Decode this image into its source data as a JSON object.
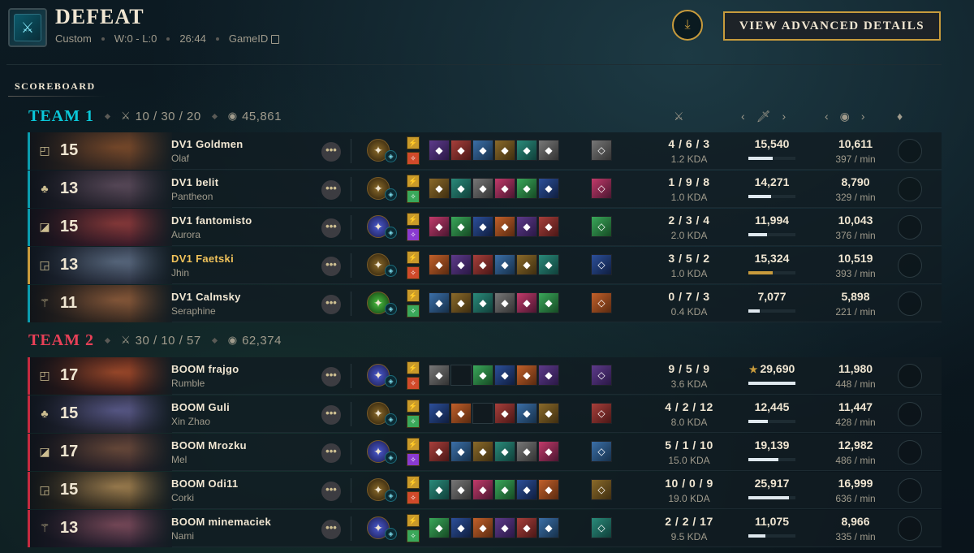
{
  "header": {
    "result": "DEFEAT",
    "mode": "Custom",
    "record": "W:0 - L:0",
    "duration": "26:44",
    "game_id_label": "GameID",
    "advanced_button": "VIEW ADVANCED DETAILS",
    "tab": "SCOREBOARD"
  },
  "team1": {
    "name": "TEAM 1",
    "kda": "10 / 30 / 20",
    "gold": "45,861",
    "players": [
      {
        "level": "15",
        "name": "DV1 Goldmen",
        "champion": "Olaf",
        "kda": "4 / 6 / 3",
        "kda_ratio": "1.2 KDA",
        "damage": "15,540",
        "damage_fraction": 0.52,
        "gold": "10,611",
        "gpm": "397 / min",
        "role": "top"
      },
      {
        "level": "13",
        "name": "DV1 belit",
        "champion": "Pantheon",
        "kda": "1 / 9 / 8",
        "kda_ratio": "1.0 KDA",
        "damage": "14,271",
        "damage_fraction": 0.48,
        "gold": "8,790",
        "gpm": "329 / min",
        "role": "jungle"
      },
      {
        "level": "15",
        "name": "DV1 fantomisto",
        "champion": "Aurora",
        "kda": "2 / 3 / 4",
        "kda_ratio": "2.0 KDA",
        "damage": "11,994",
        "damage_fraction": 0.4,
        "gold": "10,043",
        "gpm": "376 / min",
        "role": "mid"
      },
      {
        "level": "13",
        "name": "DV1 Faetski",
        "champion": "Jhin",
        "kda": "3 / 5 / 2",
        "kda_ratio": "1.0 KDA",
        "damage": "15,324",
        "damage_fraction": 0.52,
        "gold": "10,519",
        "gpm": "393 / min",
        "role": "bot",
        "is_self": true
      },
      {
        "level": "11",
        "name": "DV1 Calmsky",
        "champion": "Seraphine",
        "kda": "0 / 7 / 3",
        "kda_ratio": "0.4 KDA",
        "damage": "7,077",
        "damage_fraction": 0.24,
        "gold": "5,898",
        "gpm": "221 / min",
        "role": "support"
      }
    ]
  },
  "team2": {
    "name": "TEAM 2",
    "kda": "30 / 10 / 57",
    "gold": "62,374",
    "players": [
      {
        "level": "17",
        "name": "BOOM frajgo",
        "champion": "Rumble",
        "kda": "9 / 5 / 9",
        "kda_ratio": "3.6 KDA",
        "damage": "29,690",
        "damage_fraction": 1.0,
        "gold": "11,980",
        "gpm": "448 / min",
        "role": "top",
        "top_damage": true
      },
      {
        "level": "15",
        "name": "BOOM Guli",
        "champion": "Xin Zhao",
        "kda": "4 / 2 / 12",
        "kda_ratio": "8.0 KDA",
        "damage": "12,445",
        "damage_fraction": 0.42,
        "gold": "11,447",
        "gpm": "428 / min",
        "role": "jungle"
      },
      {
        "level": "17",
        "name": "BOOM Mrozku",
        "champion": "Mel",
        "kda": "5 / 1 / 10",
        "kda_ratio": "15.0 KDA",
        "damage": "19,139",
        "damage_fraction": 0.64,
        "gold": "12,982",
        "gpm": "486 / min",
        "role": "mid"
      },
      {
        "level": "15",
        "name": "BOOM Odi11",
        "champion": "Corki",
        "kda": "10 / 0 / 9",
        "kda_ratio": "19.0 KDA",
        "damage": "25,917",
        "damage_fraction": 0.87,
        "gold": "16,999",
        "gpm": "636 / min",
        "role": "bot"
      },
      {
        "level": "13",
        "name": "BOOM minemaciek",
        "champion": "Nami",
        "kda": "2 / 2 / 17",
        "kda_ratio": "9.5 KDA",
        "damage": "11,075",
        "damage_fraction": 0.37,
        "gold": "8,966",
        "gpm": "335 / min",
        "role": "support"
      }
    ]
  },
  "colors": {
    "team1": "#0ac8d9",
    "team2": "#e84057",
    "gold_accent": "#c89b3c"
  },
  "icons": [
    "download-icon",
    "copy-icon",
    "kda-swords-icon",
    "gold-coins-icon",
    "damage-sword-icon",
    "honor-icon",
    "more-options-icon"
  ]
}
